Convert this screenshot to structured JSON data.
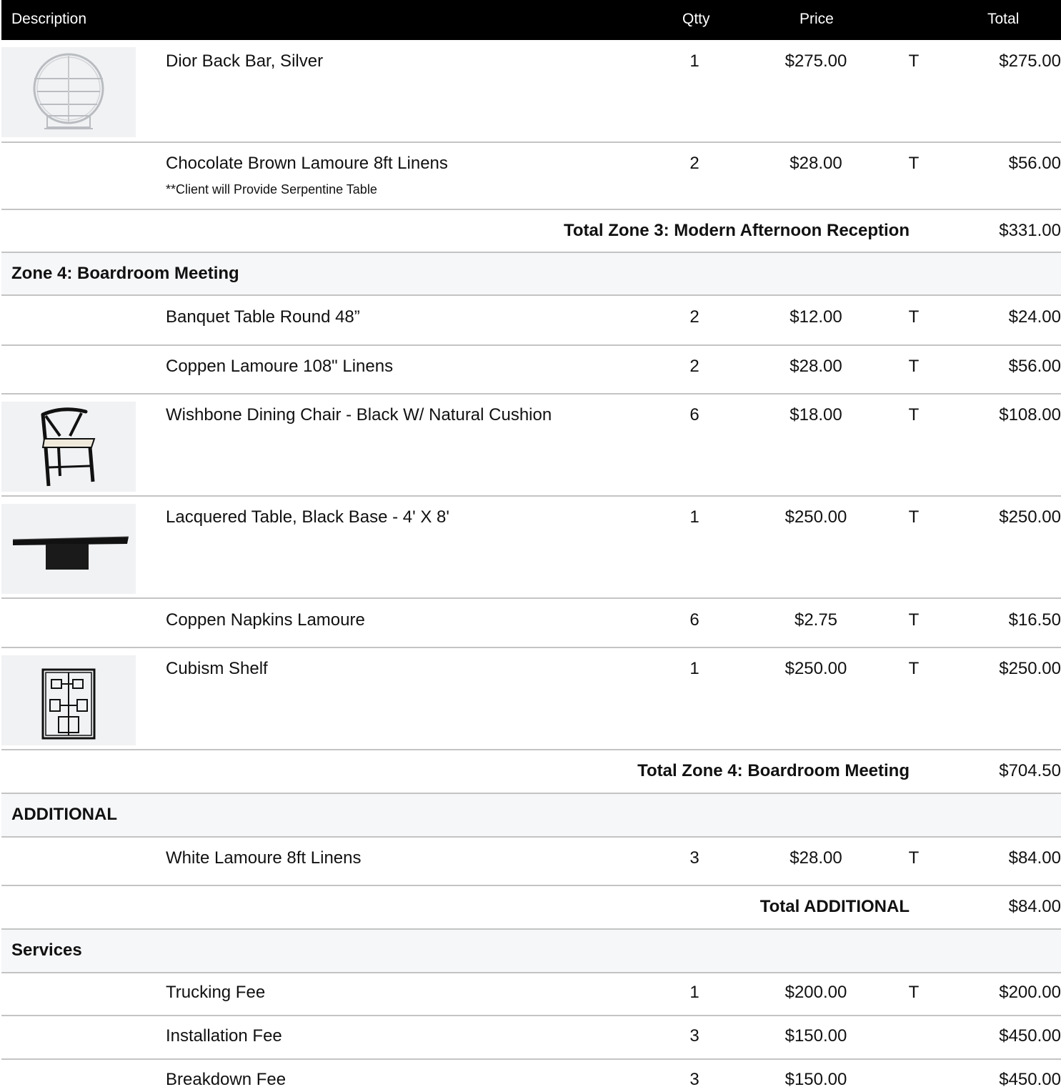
{
  "header": {
    "description": "Description",
    "qty": "Qtty",
    "price": "Price",
    "total": "Total"
  },
  "items": {
    "dior": {
      "description": "Dior Back Bar, Silver",
      "qty": "1",
      "price": "$275.00",
      "tax": "T",
      "total": "$275.00",
      "image_icon": "round-back-bar-icon"
    },
    "choc": {
      "description": "Chocolate Brown Lamoure 8ft Linens",
      "note": "**Client will Provide Serpentine Table",
      "qty": "2",
      "price": "$28.00",
      "tax": "T",
      "total": "$56.00"
    },
    "banquet": {
      "description": "Banquet Table Round 48”",
      "qty": "2",
      "price": "$12.00",
      "tax": "T",
      "total": "$24.00"
    },
    "coppen108": {
      "description": "Coppen Lamoure 108\" Linens",
      "qty": "2",
      "price": "$28.00",
      "tax": "T",
      "total": "$56.00"
    },
    "wishbone": {
      "description": "Wishbone Dining Chair - Black W/ Natural Cushion",
      "qty": "6",
      "price": "$18.00",
      "tax": "T",
      "total": "$108.00",
      "image_icon": "wishbone-chair-icon"
    },
    "lacquered": {
      "description": "Lacquered Table, Black Base - 4' X 8'",
      "qty": "1",
      "price": "$250.00",
      "tax": "T",
      "total": "$250.00",
      "image_icon": "black-table-icon"
    },
    "napkins": {
      "description": "Coppen Napkins Lamoure",
      "qty": "6",
      "price": "$2.75",
      "tax": "T",
      "total": "$16.50"
    },
    "cubism": {
      "description": "Cubism Shelf",
      "qty": "1",
      "price": "$250.00",
      "tax": "T",
      "total": "$250.00",
      "image_icon": "cubism-shelf-icon"
    },
    "white": {
      "description": "White Lamoure 8ft Linens",
      "qty": "3",
      "price": "$28.00",
      "tax": "T",
      "total": "$84.00"
    },
    "trucking": {
      "description": "Trucking Fee",
      "qty": "1",
      "price": "$200.00",
      "tax": "T",
      "total": "$200.00"
    },
    "install": {
      "description": "Installation Fee",
      "qty": "3",
      "price": "$150.00",
      "tax": "",
      "total": "$450.00"
    },
    "breakdown": {
      "description": "Breakdown Fee",
      "qty": "3",
      "price": "$150.00",
      "tax": "",
      "total": "$450.00"
    }
  },
  "subtotals": {
    "zone3": {
      "label": "Total Zone 3: Modern Afternoon Reception",
      "total": "$331.00"
    },
    "zone4": {
      "label": "Total Zone 4: Boardroom Meeting",
      "total": "$704.50"
    },
    "additional": {
      "label": "Total ADDITIONAL",
      "total": "$84.00"
    }
  },
  "zones": {
    "zone4": "Zone 4: Boardroom Meeting",
    "additional": "ADDITIONAL",
    "services": "Services"
  },
  "colors": {
    "header_bg": "#000000",
    "header_text": "#ffffff",
    "zone_bg": "#f6f7f9",
    "divider": "#c4c4c4"
  }
}
